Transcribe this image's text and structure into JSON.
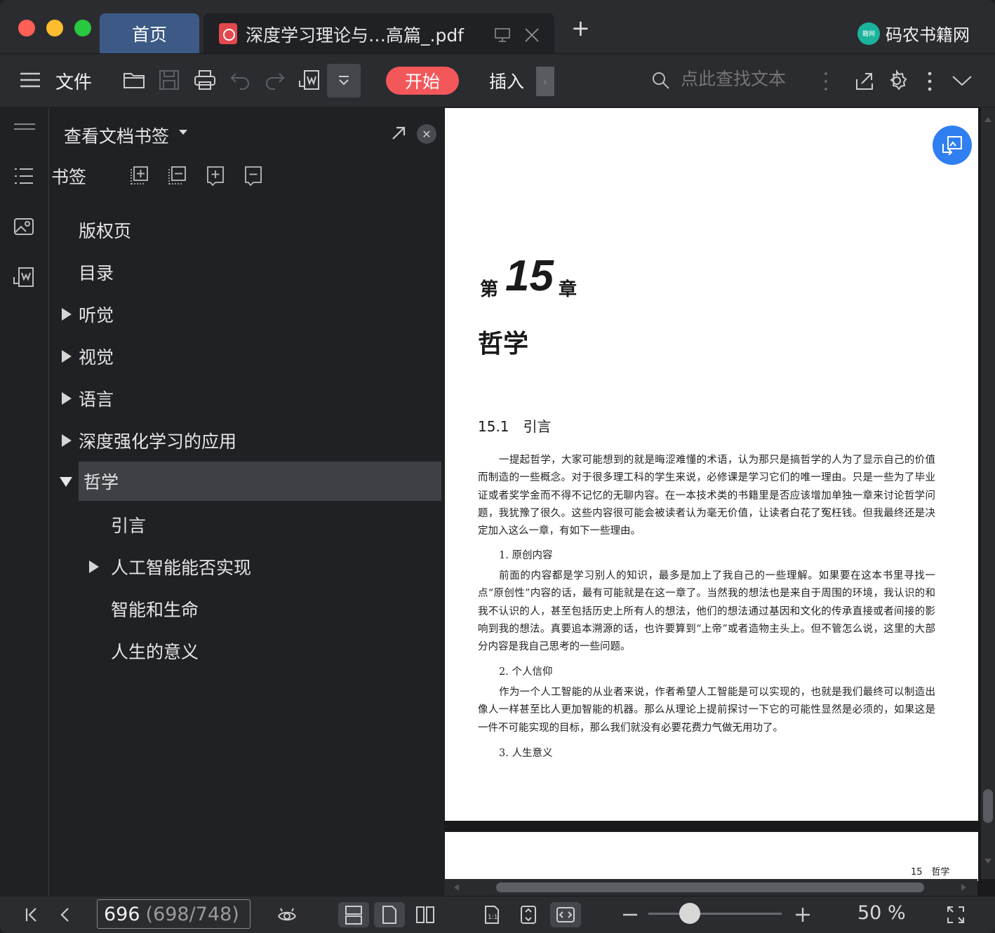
{
  "tabs": {
    "home": "首页",
    "doc": "深度学习理论与…高篇_.pdf"
  },
  "brand": {
    "logo_text": "籍网",
    "name": "码农书籍网"
  },
  "toolbar": {
    "file_label": "文件",
    "start_label": "开始",
    "insert_label": "插入",
    "search_placeholder": "点此查找文本"
  },
  "panel": {
    "title": "查看文档书签",
    "bookmark_label": "书签",
    "items": [
      {
        "label": "版权页"
      },
      {
        "label": "目录"
      },
      {
        "label": "听觉"
      },
      {
        "label": "视觉"
      },
      {
        "label": "语言"
      },
      {
        "label": "深度强化学习的应用"
      },
      {
        "label": "哲学"
      },
      {
        "label": "引言"
      },
      {
        "label": "人工智能能否实现"
      },
      {
        "label": "智能和生命"
      },
      {
        "label": "人生的意义"
      }
    ]
  },
  "document": {
    "chapter_prefix": "第",
    "chapter_number": "15",
    "chapter_suffix": "章",
    "chapter_title": "哲学",
    "section": "15.1　引言",
    "para1": "一提起哲学，大家可能想到的就是晦涩难懂的术语，认为那只是搞哲学的人为了显示自己的价值而制造的一些概念。对于很多理工科的学生来说，必修课是学习它们的唯一理由。只是一些为了毕业证或者奖学金而不得不记忆的无聊内容。在一本技术类的书籍里是否应该增加单独一章来讨论哲学问题，我犹豫了很久。这些内容很可能会被读者认为毫无价值，让读者白花了冤枉钱。但我最终还是决定加入这么一章，有如下一些理由。",
    "sub1": "1. 原创内容",
    "para2": "前面的内容都是学习别人的知识，最多是加上了我自己的一些理解。如果要在这本书里寻找一点“原创性”内容的话，最有可能就是在这一章了。当然我的想法也是来自于周围的环境，我认识的和我不认识的人，甚至包括历史上所有人的想法，他们的想法通过基因和文化的传承直接或者间接的影响到我的想法。真要追本溯源的话，也许要算到“上帝”或者造物主头上。但不管怎么说，这里的大部分内容是我自己思考的一些问题。",
    "sub2": "2. 个人信仰",
    "para3": "作为一个人工智能的从业者来说，作者希望人工智能是可以实现的，也就是我们最终可以制造出像人一样甚至比人更加智能的机器。那么从理论上提前探讨一下它的可能性显然是必须的，如果这是一件不可能实现的目标，那么我们就没有必要花费力气做无用功了。",
    "sub3": "3. 人生意义",
    "footer": "15　哲学"
  },
  "status": {
    "current_page": "696",
    "total_pages": "(698/748)",
    "zoom": "50 %"
  },
  "colors": {
    "accent": "#f3575a",
    "tab_active": "#3c5a85",
    "float_button": "#2f7ff1",
    "brand": "#1cb39c"
  }
}
